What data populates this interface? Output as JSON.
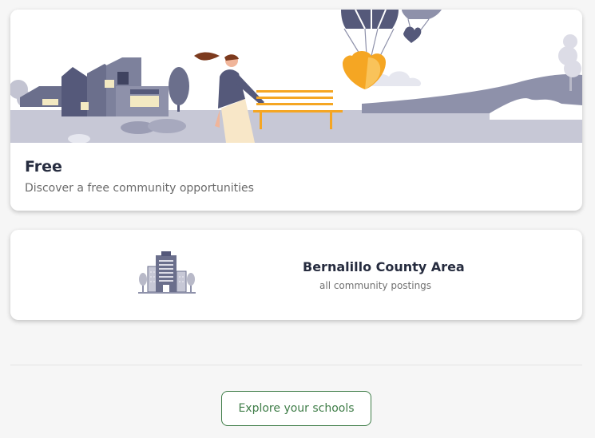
{
  "cards": {
    "free": {
      "title": "Free",
      "description": "Discover a free community opportunities",
      "illustration": "community-park-illustration"
    },
    "area": {
      "title": "Bernalillo County Area",
      "subtitle": "all community postings",
      "icon": "building-icon"
    }
  },
  "explore_button": {
    "label": "Explore your schools"
  },
  "colors": {
    "accent_green": "#3f7d48",
    "title_text": "#262c3f",
    "illustration_navy": "#55597a",
    "illustration_orange": "#f5a623"
  }
}
